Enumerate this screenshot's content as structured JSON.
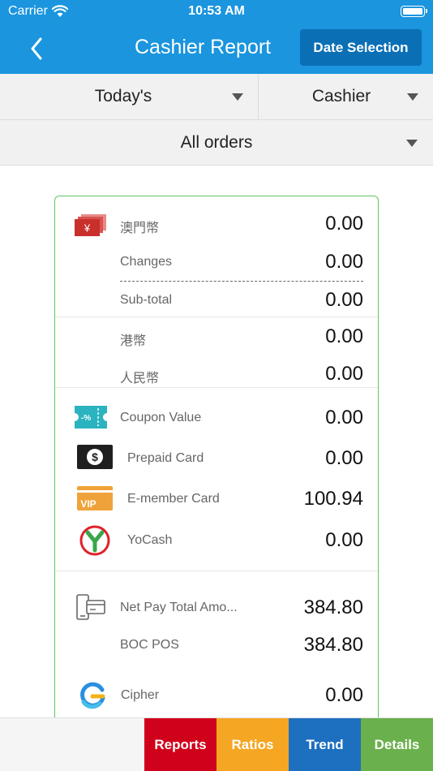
{
  "status_bar": {
    "carrier": "Carrier",
    "time": "10:53 AM"
  },
  "header": {
    "title": "Cashier Report",
    "date_button": "Date Selection"
  },
  "filters": {
    "period": "Today's",
    "cashier": "Cashier",
    "orders": "All orders"
  },
  "report": {
    "mop": {
      "label": "澳門幣",
      "value": "0.00",
      "icon": "cash-icon"
    },
    "changes": {
      "label": "Changes",
      "value": "0.00"
    },
    "subtotal": {
      "label": "Sub-total",
      "value": "0.00"
    },
    "hkd": {
      "label": "港幣",
      "value": "0.00"
    },
    "rmb": {
      "label": "人民幣",
      "value": "0.00"
    },
    "coupon": {
      "label": "Coupon Value",
      "value": "0.00",
      "icon": "coupon-icon"
    },
    "prepaid": {
      "label": "Prepaid Card",
      "value": "0.00",
      "icon": "prepaid-card-icon"
    },
    "emember": {
      "label": "E-member Card",
      "value": "100.94",
      "icon": "vip-card-icon"
    },
    "yocash": {
      "label": "YoCash",
      "value": "0.00",
      "icon": "yocash-icon"
    },
    "netpay": {
      "label": "Net Pay Total Amo...",
      "value": "384.80",
      "icon": "pos-terminal-icon"
    },
    "boc": {
      "label": "BOC POS",
      "value": "384.80"
    },
    "cipher": {
      "label": "Cipher",
      "value": "0.00",
      "icon": "cipher-icon"
    }
  },
  "icon_text": {
    "yen": "¥",
    "discount": "-%",
    "dollar": "$",
    "vip": "VIP"
  },
  "tabs": {
    "reports": "Reports",
    "ratios": "Ratios",
    "trend": "Trend",
    "details": "Details"
  },
  "colors": {
    "header": "#1a95de",
    "date_button": "#0b6fb6",
    "card_border": "#5ec762",
    "reports": "#d0021b",
    "ratios": "#f5a623",
    "trend": "#1d6fc0",
    "details": "#6ab04c"
  }
}
